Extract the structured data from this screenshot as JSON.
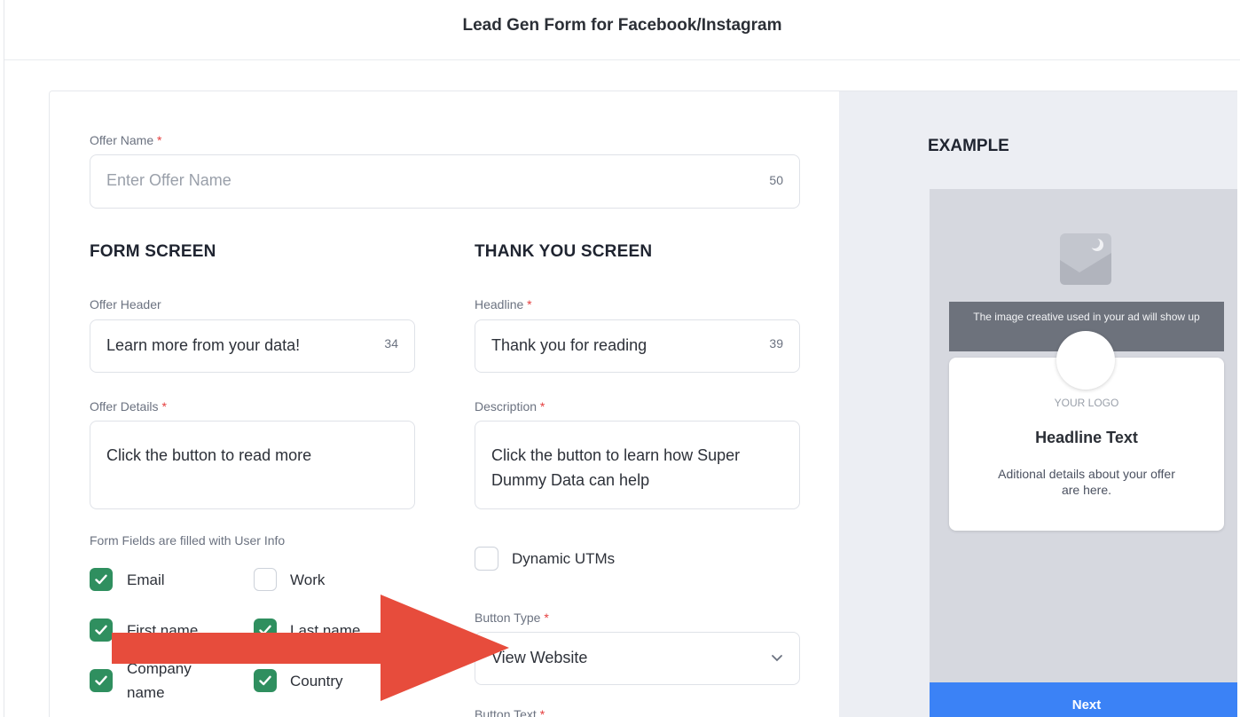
{
  "modal": {
    "title": "Lead Gen Form for Facebook/Instagram"
  },
  "offer_name": {
    "label": "Offer Name",
    "required": "*",
    "placeholder": "Enter Offer Name",
    "count": "50"
  },
  "form_screen": {
    "heading": "FORM SCREEN",
    "offer_header": {
      "label": "Offer Header",
      "value": "Learn more from your data!",
      "count": "34"
    },
    "offer_details": {
      "label": "Offer Details",
      "required": "*",
      "value": "Click the button to read more"
    },
    "fields_note": "Form Fields are filled with User Info",
    "fields": [
      {
        "label": "Email",
        "checked": true
      },
      {
        "label": "Work",
        "checked": false
      },
      {
        "label": "First name",
        "checked": true
      },
      {
        "label": "Last name",
        "checked": true
      },
      {
        "label": "Company name",
        "checked": true
      },
      {
        "label": "Country",
        "checked": true
      }
    ]
  },
  "thank_you_screen": {
    "heading": "THANK YOU SCREEN",
    "headline": {
      "label": "Headline",
      "required": "*",
      "value": "Thank you for reading",
      "count": "39"
    },
    "description": {
      "label": "Description",
      "required": "*",
      "value": "Click the button to learn how Super Dummy Data can help"
    },
    "dynamic_utms": {
      "label": "Dynamic UTMs",
      "checked": false
    },
    "button_type": {
      "label": "Button Type",
      "required": "*",
      "value": "View Website"
    },
    "button_text": {
      "label": "Button Text",
      "required": "*"
    }
  },
  "example": {
    "heading": "EXAMPLE",
    "banner": "The image creative used in your ad will show up",
    "logo": "YOUR LOGO",
    "headline": "Headline Text",
    "details": "Aditional details about your offer are here.",
    "next": "Next"
  },
  "colors": {
    "checkbox_on": "#2f8f5f",
    "arrow": "#e74c3c",
    "next_button": "#3b82f6",
    "required": "#e53e3e"
  }
}
